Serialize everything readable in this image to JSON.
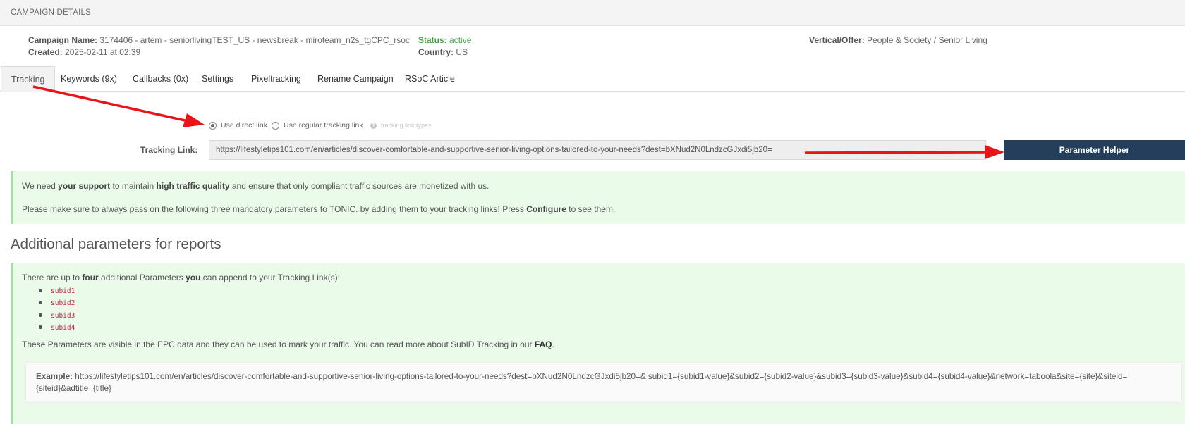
{
  "header": {
    "title": "CAMPAIGN DETAILS"
  },
  "campaign": {
    "name_label": "Campaign Name:",
    "name_value": "3174406 - artem - seniorlivingTEST_US - newsbreak - miroteam_n2s_tgCPC_rsoc",
    "created_label": "Created:",
    "created_value": "2025-02-11 at 02:39",
    "status_label": "Status:",
    "status_value": "active",
    "country_label": "Country:",
    "country_value": "US",
    "vertical_label": "Vertical/Offer:",
    "vertical_value": "People & Society / Senior Living"
  },
  "tabs": [
    {
      "label": "Tracking",
      "active": true
    },
    {
      "label": "Keywords (9x)"
    },
    {
      "label": "Callbacks (0x)"
    },
    {
      "label": "Settings"
    },
    {
      "label": "Pixeltracking"
    },
    {
      "label": "Rename Campaign"
    },
    {
      "label": "RSoC Article"
    }
  ],
  "link_type": {
    "direct_label": "Use direct link",
    "regular_label": "Use regular tracking link",
    "selected": "direct",
    "hint": "tracking link types"
  },
  "tracking": {
    "label": "Tracking Link:",
    "value": "https://lifestyletips101.com/en/articles/discover-comfortable-and-supportive-senior-living-options-tailored-to-your-needs?dest=bXNud2N0LndzcGJxdi5jb20=",
    "button": "Parameter Helper"
  },
  "notice": {
    "l1_a": "We need ",
    "l1_b": "your support",
    "l1_c": " to maintain ",
    "l1_d": "high traffic quality",
    "l1_e": " and ensure that only compliant traffic sources are monetized with us.",
    "l2_a": "Please make sure to always pass on the following three mandatory parameters to TONIC. by adding them to your tracking links! Press ",
    "l2_b": "Configure",
    "l2_c": " to see them."
  },
  "additional": {
    "title": "Additional parameters for reports",
    "intro_a": "There are up to ",
    "intro_b": "four",
    "intro_c": " additional Parameters ",
    "intro_d": "you",
    "intro_e": " can append to your Tracking Link(s):",
    "params": [
      "subid1",
      "subid2",
      "subid3",
      "subid4"
    ],
    "desc_a": "These Parameters are visible in the EPC data and they can be used to mark your traffic. You can read more about SubID Tracking in our ",
    "desc_link": "FAQ",
    "desc_c": ".",
    "example_label": "Example:",
    "example_line1": " https://lifestyletips101.com/en/articles/discover-comfortable-and-supportive-senior-living-options-tailored-to-your-needs?dest=bXNud2N0LndzcGJxdi5jb20=& subid1={subid1-value}&subid2={subid2-value}&subid3={subid3-value}&subid4={subid4-value}&network=taboola&site={site}&siteid=",
    "example_line2": "{siteid}&adtitle={title}"
  },
  "colors": {
    "accent_button": "#243e5c",
    "status_green": "#3fa63f",
    "notice_bg": "#eafbea",
    "annotation_red": "#e8141a"
  }
}
